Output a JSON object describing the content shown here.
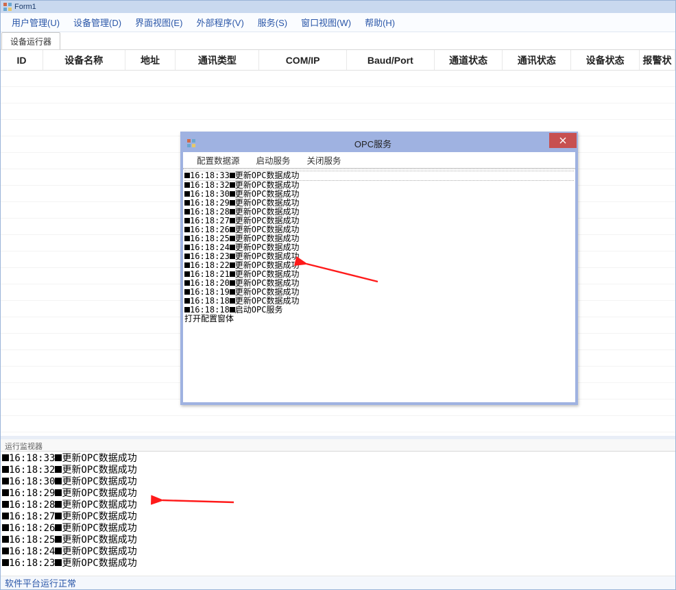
{
  "window": {
    "title": "Form1"
  },
  "menu": {
    "items": [
      "用户管理(U)",
      "设备管理(D)",
      "界面视图(E)",
      "外部程序(V)",
      "服务(S)",
      "窗口视图(W)",
      "帮助(H)"
    ]
  },
  "tabs": {
    "active": "设备运行器"
  },
  "grid": {
    "columns": [
      "ID",
      "设备名称",
      "地址",
      "通讯类型",
      "COM/IP",
      "Baud/Port",
      "通道状态",
      "通讯状态",
      "设备状态",
      "报警状"
    ]
  },
  "monitor": {
    "label": "运行监视器",
    "logs": [
      {
        "time": "16:18:33",
        "msg": "更新OPC数据成功"
      },
      {
        "time": "16:18:32",
        "msg": "更新OPC数据成功"
      },
      {
        "time": "16:18:30",
        "msg": "更新OPC数据成功"
      },
      {
        "time": "16:18:29",
        "msg": "更新OPC数据成功"
      },
      {
        "time": "16:18:28",
        "msg": "更新OPC数据成功"
      },
      {
        "time": "16:18:27",
        "msg": "更新OPC数据成功"
      },
      {
        "time": "16:18:26",
        "msg": "更新OPC数据成功"
      },
      {
        "time": "16:18:25",
        "msg": "更新OPC数据成功"
      },
      {
        "time": "16:18:24",
        "msg": "更新OPC数据成功"
      },
      {
        "time": "16:18:23",
        "msg": "更新OPC数据成功"
      }
    ]
  },
  "status": {
    "text": "软件平台运行正常"
  },
  "dialog": {
    "title": "OPC服务",
    "menu": [
      "配置数据源",
      "启动服务",
      "关闭服务"
    ],
    "logs": [
      {
        "time": "16:18:33",
        "msg": "更新OPC数据成功"
      },
      {
        "time": "16:18:32",
        "msg": "更新OPC数据成功"
      },
      {
        "time": "16:18:30",
        "msg": "更新OPC数据成功"
      },
      {
        "time": "16:18:29",
        "msg": "更新OPC数据成功"
      },
      {
        "time": "16:18:28",
        "msg": "更新OPC数据成功"
      },
      {
        "time": "16:18:27",
        "msg": "更新OPC数据成功"
      },
      {
        "time": "16:18:26",
        "msg": "更新OPC数据成功"
      },
      {
        "time": "16:18:25",
        "msg": "更新OPC数据成功"
      },
      {
        "time": "16:18:24",
        "msg": "更新OPC数据成功"
      },
      {
        "time": "16:18:23",
        "msg": "更新OPC数据成功"
      },
      {
        "time": "16:18:22",
        "msg": "更新OPC数据成功"
      },
      {
        "time": "16:18:21",
        "msg": "更新OPC数据成功"
      },
      {
        "time": "16:18:20",
        "msg": "更新OPC数据成功"
      },
      {
        "time": "16:18:19",
        "msg": "更新OPC数据成功"
      },
      {
        "time": "16:18:18",
        "msg": "更新OPC数据成功"
      },
      {
        "time": "16:18:18",
        "msg": "启动OPC服务"
      }
    ],
    "plain_logs": [
      "打开配置窗体"
    ]
  }
}
